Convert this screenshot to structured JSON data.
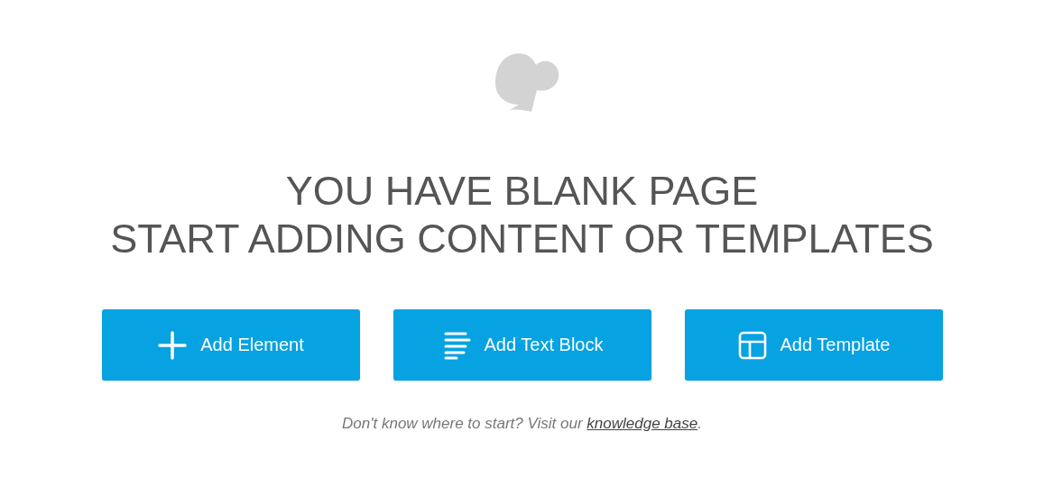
{
  "heading": [
    "YOU HAVE BLANK PAGE",
    "START ADDING CONTENT OR TEMPLATES"
  ],
  "buttons": [
    {
      "label": "Add Element",
      "kind": "plus"
    },
    {
      "label": "Add Text Block",
      "kind": "lines"
    },
    {
      "label": "Add Template",
      "kind": "layout"
    }
  ],
  "hint": {
    "text": "Don't know where to start? Visit our ",
    "link": "knowledge base",
    "after": "."
  }
}
